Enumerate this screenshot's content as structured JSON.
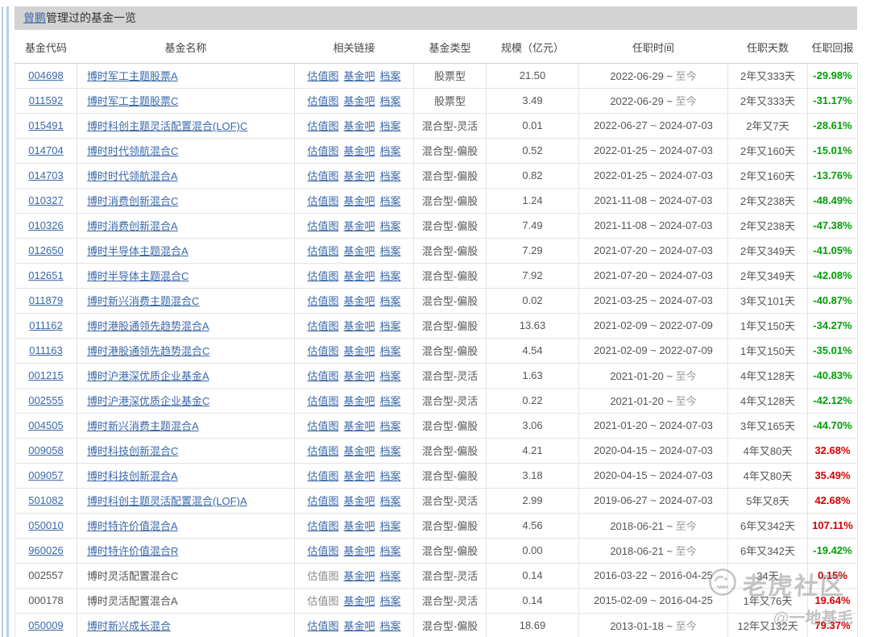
{
  "page": {
    "manager_name": "曾鹏",
    "title_suffix": "管理过的基金一览"
  },
  "colors": {
    "link_blue": "#3b68a8",
    "positive_return_red": "#d50000",
    "negative_return_green": "#009e06",
    "title_bar_bg": "#d3d3d3"
  },
  "table": {
    "headers": [
      "基金代码",
      "基金名称",
      "相关链接",
      "基金类型",
      "规模（亿元）",
      "任职时间",
      "任职天数",
      "任职回报"
    ],
    "link_labels": [
      "估值图",
      "基金吧",
      "档案"
    ],
    "rows": [
      {
        "code": "004698",
        "name": "博时军工主题股票A",
        "linked": true,
        "gvt": true,
        "type": "股票型",
        "scale": "21.50",
        "start": "2022-06-29",
        "end": "至今",
        "current": true,
        "days": "2年又333天",
        "ret": "-29.98%",
        "up": false
      },
      {
        "code": "011592",
        "name": "博时军工主题股票C",
        "linked": true,
        "gvt": true,
        "type": "股票型",
        "scale": "3.49",
        "start": "2022-06-29",
        "end": "至今",
        "current": true,
        "days": "2年又333天",
        "ret": "-31.17%",
        "up": false
      },
      {
        "code": "015491",
        "name": "博时科创主题灵活配置混合(LOF)C",
        "linked": true,
        "gvt": true,
        "type": "混合型-灵活",
        "scale": "0.01",
        "start": "2022-06-27",
        "end": "2024-07-03",
        "current": false,
        "days": "2年又7天",
        "ret": "-28.61%",
        "up": false
      },
      {
        "code": "014704",
        "name": "博时时代领航混合C",
        "linked": true,
        "gvt": true,
        "type": "混合型-偏股",
        "scale": "0.52",
        "start": "2022-01-25",
        "end": "2024-07-03",
        "current": false,
        "days": "2年又160天",
        "ret": "-15.01%",
        "up": false
      },
      {
        "code": "014703",
        "name": "博时时代领航混合A",
        "linked": true,
        "gvt": true,
        "type": "混合型-偏股",
        "scale": "0.82",
        "start": "2022-01-25",
        "end": "2024-07-03",
        "current": false,
        "days": "2年又160天",
        "ret": "-13.76%",
        "up": false
      },
      {
        "code": "010327",
        "name": "博时消费创新混合C",
        "linked": true,
        "gvt": true,
        "type": "混合型-偏股",
        "scale": "1.24",
        "start": "2021-11-08",
        "end": "2024-07-03",
        "current": false,
        "days": "2年又238天",
        "ret": "-48.49%",
        "up": false
      },
      {
        "code": "010326",
        "name": "博时消费创新混合A",
        "linked": true,
        "gvt": true,
        "type": "混合型-偏股",
        "scale": "7.49",
        "start": "2021-11-08",
        "end": "2024-07-03",
        "current": false,
        "days": "2年又238天",
        "ret": "-47.38%",
        "up": false
      },
      {
        "code": "012650",
        "name": "博时半导体主题混合A",
        "linked": true,
        "gvt": true,
        "type": "混合型-偏股",
        "scale": "7.29",
        "start": "2021-07-20",
        "end": "2024-07-03",
        "current": false,
        "days": "2年又349天",
        "ret": "-41.05%",
        "up": false
      },
      {
        "code": "012651",
        "name": "博时半导体主题混合C",
        "linked": true,
        "gvt": true,
        "type": "混合型-偏股",
        "scale": "7.92",
        "start": "2021-07-20",
        "end": "2024-07-03",
        "current": false,
        "days": "2年又349天",
        "ret": "-42.08%",
        "up": false
      },
      {
        "code": "011879",
        "name": "博时新兴消费主题混合C",
        "linked": true,
        "gvt": true,
        "type": "混合型-偏股",
        "scale": "0.02",
        "start": "2021-03-25",
        "end": "2024-07-03",
        "current": false,
        "days": "3年又101天",
        "ret": "-40.87%",
        "up": false
      },
      {
        "code": "011162",
        "name": "博时港股通领先趋势混合A",
        "linked": true,
        "gvt": true,
        "type": "混合型-偏股",
        "scale": "13.63",
        "start": "2021-02-09",
        "end": "2022-07-09",
        "current": false,
        "days": "1年又150天",
        "ret": "-34.27%",
        "up": false
      },
      {
        "code": "011163",
        "name": "博时港股通领先趋势混合C",
        "linked": true,
        "gvt": true,
        "type": "混合型-偏股",
        "scale": "4.54",
        "start": "2021-02-09",
        "end": "2022-07-09",
        "current": false,
        "days": "1年又150天",
        "ret": "-35.01%",
        "up": false
      },
      {
        "code": "001215",
        "name": "博时沪港深优质企业基金A",
        "linked": true,
        "gvt": true,
        "type": "混合型-灵活",
        "scale": "1.63",
        "start": "2021-01-20",
        "end": "至今",
        "current": true,
        "days": "4年又128天",
        "ret": "-40.83%",
        "up": false
      },
      {
        "code": "002555",
        "name": "博时沪港深优质企业基金C",
        "linked": true,
        "gvt": true,
        "type": "混合型-灵活",
        "scale": "0.22",
        "start": "2021-01-20",
        "end": "至今",
        "current": true,
        "days": "4年又128天",
        "ret": "-42.12%",
        "up": false
      },
      {
        "code": "004505",
        "name": "博时新兴消费主题混合A",
        "linked": true,
        "gvt": true,
        "type": "混合型-偏股",
        "scale": "3.06",
        "start": "2021-01-20",
        "end": "2024-07-03",
        "current": false,
        "days": "3年又165天",
        "ret": "-44.70%",
        "up": false
      },
      {
        "code": "009058",
        "name": "博时科技创新混合C",
        "linked": true,
        "gvt": true,
        "type": "混合型-偏股",
        "scale": "4.21",
        "start": "2020-04-15",
        "end": "2024-07-03",
        "current": false,
        "days": "4年又80天",
        "ret": "32.68%",
        "up": true
      },
      {
        "code": "009057",
        "name": "博时科技创新混合A",
        "linked": true,
        "gvt": true,
        "type": "混合型-偏股",
        "scale": "3.18",
        "start": "2020-04-15",
        "end": "2024-07-03",
        "current": false,
        "days": "4年又80天",
        "ret": "35.49%",
        "up": true
      },
      {
        "code": "501082",
        "name": "博时科创主题灵活配置混合(LOF)A",
        "linked": true,
        "gvt": true,
        "type": "混合型-灵活",
        "scale": "2.99",
        "start": "2019-06-27",
        "end": "2024-07-03",
        "current": false,
        "days": "5年又8天",
        "ret": "42.68%",
        "up": true
      },
      {
        "code": "050010",
        "name": "博时特许价值混合A",
        "linked": true,
        "gvt": true,
        "type": "混合型-偏股",
        "scale": "4.56",
        "start": "2018-06-21",
        "end": "至今",
        "current": true,
        "days": "6年又342天",
        "ret": "107.11%",
        "up": true
      },
      {
        "code": "960026",
        "name": "博时特许价值混合R",
        "linked": true,
        "gvt": true,
        "type": "混合型-偏股",
        "scale": "0.00",
        "start": "2018-06-21",
        "end": "至今",
        "current": true,
        "days": "6年又342天",
        "ret": "-19.42%",
        "up": false
      },
      {
        "code": "002557",
        "name": "博时灵活配置混合C",
        "linked": false,
        "gvt": false,
        "type": "混合型-灵活",
        "scale": "0.14",
        "start": "2016-03-22",
        "end": "2016-04-25",
        "current": false,
        "days": "34天",
        "ret": "0.15%",
        "up": true
      },
      {
        "code": "000178",
        "name": "博时灵活配置混合A",
        "linked": false,
        "gvt": false,
        "type": "混合型-灵活",
        "scale": "0.14",
        "start": "2015-02-09",
        "end": "2016-04-25",
        "current": false,
        "days": "1年又76天",
        "ret": "19.64%",
        "up": true
      },
      {
        "code": "050009",
        "name": "博时新兴成长混合",
        "linked": true,
        "gvt": true,
        "type": "混合型-偏股",
        "scale": "18.69",
        "start": "2013-01-18",
        "end": "至今",
        "current": true,
        "days": "12年又132天",
        "ret": "79.37%",
        "up": true
      }
    ]
  },
  "watermark": {
    "brand": "老虎社区",
    "handle": "@一地基毛"
  }
}
